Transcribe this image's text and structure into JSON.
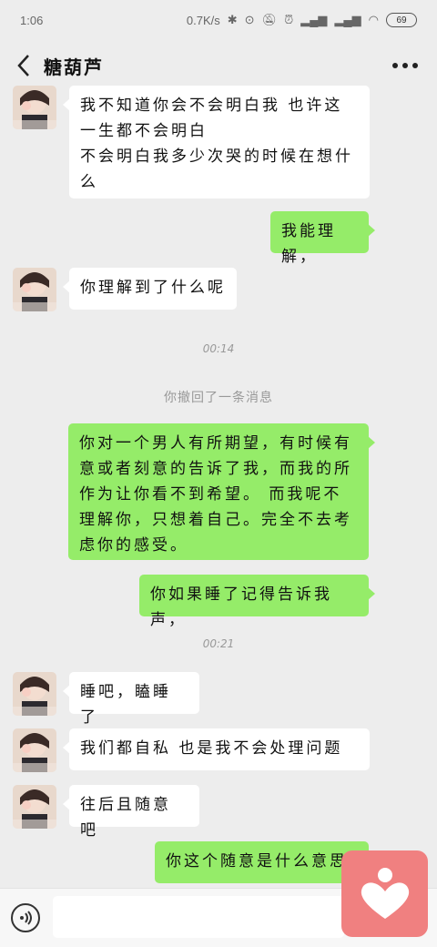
{
  "status_bar": {
    "time": "1:06",
    "net_speed": "0.7K/s",
    "battery": "69"
  },
  "header": {
    "title": "糖葫芦",
    "more_icon": "more-icon"
  },
  "messages": {
    "m1": {
      "direction": "in",
      "lines": [
        "我不知道你会不会明白我   也许这",
        "一生都不会明白",
        "不会明白我多少次哭的时候在想什",
        "么"
      ]
    },
    "m2": {
      "direction": "out",
      "text": "我能理解，"
    },
    "m3": {
      "direction": "in",
      "text": "你理解到了什么呢"
    },
    "t1": "00:14",
    "sys1": "你撤回了一条消息",
    "m4": {
      "direction": "out",
      "lines": [
        "你对一个男人有所期望，有时候有",
        "意或者刻意的告诉了我，而我的所",
        "作为让你看不到希望。  而我呢不",
        "理解你，只想着自己。完全不去考",
        "虑你的感受。"
      ]
    },
    "m5": {
      "direction": "out",
      "text": "你如果睡了记得告诉我声，"
    },
    "t2": "00:21",
    "m6": {
      "direction": "in",
      "text": "睡吧，瞌睡了"
    },
    "m7": {
      "direction": "in",
      "text": "我们都自私  也是我不会处理问题"
    },
    "m8": {
      "direction": "in",
      "text": "往后且随意吧"
    },
    "m9": {
      "direction": "out",
      "text": "你这个随意是什么意思"
    }
  },
  "input_bar": {
    "placeholder": "",
    "voice_icon": "voice-icon"
  },
  "colors": {
    "background": "#ededed",
    "outgoing_bubble": "#95ec69",
    "incoming_bubble": "#ffffff",
    "floating_button": "#f08080"
  }
}
